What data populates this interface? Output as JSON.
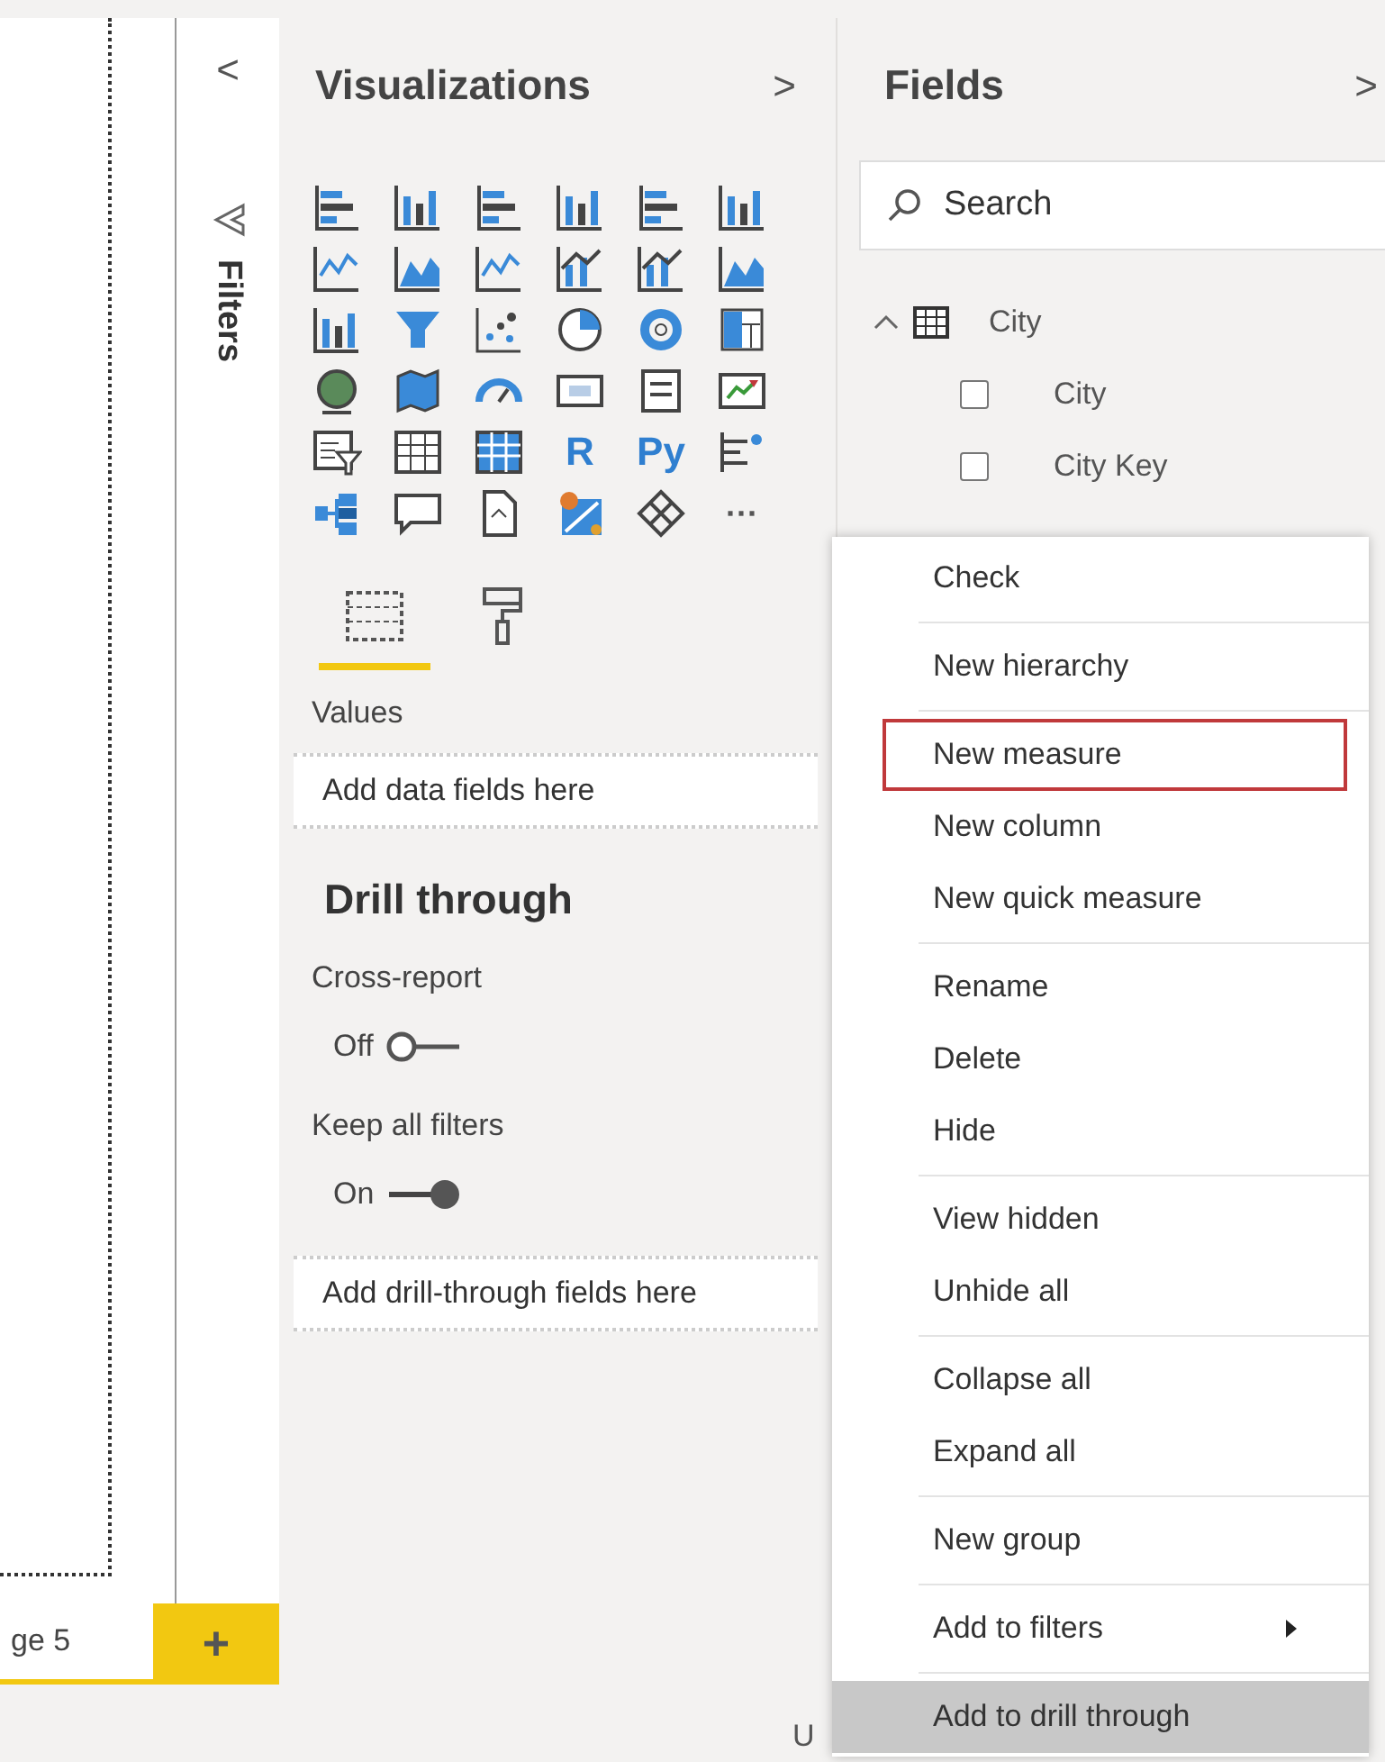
{
  "page_tabs": [
    {
      "label": "ge 5",
      "selected": true
    }
  ],
  "add_page_button": {
    "label": "+"
  },
  "filters_pane": {
    "collapse_glyph": "<",
    "title": "Filters"
  },
  "visualizations": {
    "title": "Visualizations",
    "expand_glyph": ">",
    "gallery": [
      {
        "kind": "hbars"
      },
      {
        "kind": "vbars"
      },
      {
        "kind": "hbars"
      },
      {
        "kind": "vbars"
      },
      {
        "kind": "hbars"
      },
      {
        "kind": "vbars"
      },
      {
        "kind": "line"
      },
      {
        "kind": "area"
      },
      {
        "kind": "line"
      },
      {
        "kind": "combo"
      },
      {
        "kind": "combo"
      },
      {
        "kind": "area"
      },
      {
        "kind": "vbars"
      },
      {
        "kind": "funnel"
      },
      {
        "kind": "scatter"
      },
      {
        "kind": "pie"
      },
      {
        "kind": "donut"
      },
      {
        "kind": "treemap"
      },
      {
        "kind": "globe"
      },
      {
        "kind": "map"
      },
      {
        "kind": "gauge"
      },
      {
        "kind": "card"
      },
      {
        "kind": "list"
      },
      {
        "kind": "kpi"
      },
      {
        "kind": "slicer"
      },
      {
        "kind": "table"
      },
      {
        "kind": "matrix"
      },
      {
        "kind": "script",
        "label": "R"
      },
      {
        "kind": "script",
        "label": "Py"
      },
      {
        "kind": "branch"
      },
      {
        "kind": "tree"
      },
      {
        "kind": "bubble"
      },
      {
        "kind": "document"
      },
      {
        "kind": "pin"
      },
      {
        "kind": "diamond"
      },
      {
        "kind": "more",
        "label": "···"
      }
    ],
    "tabs": [
      {
        "kind": "fields",
        "selected": true
      },
      {
        "kind": "format",
        "selected": false
      }
    ],
    "values_label": "Values",
    "values_well": "Add data fields here",
    "drill_through": {
      "title": "Drill through",
      "toggles": [
        {
          "label": "Cross-report",
          "state_label": "Off",
          "on": false
        },
        {
          "label": "Keep all filters",
          "state_label": "On",
          "on": true
        }
      ],
      "well": "Add drill-through fields here"
    }
  },
  "fields": {
    "title": "Fields",
    "expand_glyph": ">",
    "search": {
      "placeholder": "Search"
    },
    "tables": [
      {
        "name": "City",
        "expanded": true,
        "fields": [
          {
            "name": "City",
            "checked": false
          },
          {
            "name": "City Key",
            "checked": false
          }
        ]
      }
    ]
  },
  "context_menu": {
    "groups": [
      [
        {
          "label": "Check",
          "selected": false,
          "outlined": false,
          "submenu": false
        }
      ],
      [
        {
          "label": "New hierarchy",
          "selected": false,
          "outlined": false,
          "submenu": false
        }
      ],
      [
        {
          "label": "New measure",
          "selected": false,
          "outlined": true,
          "submenu": false
        },
        {
          "label": "New column",
          "selected": false,
          "outlined": false,
          "submenu": false
        },
        {
          "label": "New quick measure",
          "selected": false,
          "outlined": false,
          "submenu": false
        }
      ],
      [
        {
          "label": "Rename",
          "selected": false,
          "outlined": false,
          "submenu": false
        },
        {
          "label": "Delete",
          "selected": false,
          "outlined": false,
          "submenu": false
        },
        {
          "label": "Hide",
          "selected": false,
          "outlined": false,
          "submenu": false
        }
      ],
      [
        {
          "label": "View hidden",
          "selected": false,
          "outlined": false,
          "submenu": false
        },
        {
          "label": "Unhide all",
          "selected": false,
          "outlined": false,
          "submenu": false
        }
      ],
      [
        {
          "label": "Collapse all",
          "selected": false,
          "outlined": false,
          "submenu": false
        },
        {
          "label": "Expand all",
          "selected": false,
          "outlined": false,
          "submenu": false
        }
      ],
      [
        {
          "label": "New group",
          "selected": false,
          "outlined": false,
          "submenu": false
        }
      ],
      [
        {
          "label": "Add to filters",
          "selected": false,
          "outlined": false,
          "submenu": true
        }
      ],
      [
        {
          "label": "Add to drill through",
          "selected": true,
          "outlined": false,
          "submenu": false
        }
      ]
    ]
  },
  "status_bar": {
    "text": "U"
  }
}
